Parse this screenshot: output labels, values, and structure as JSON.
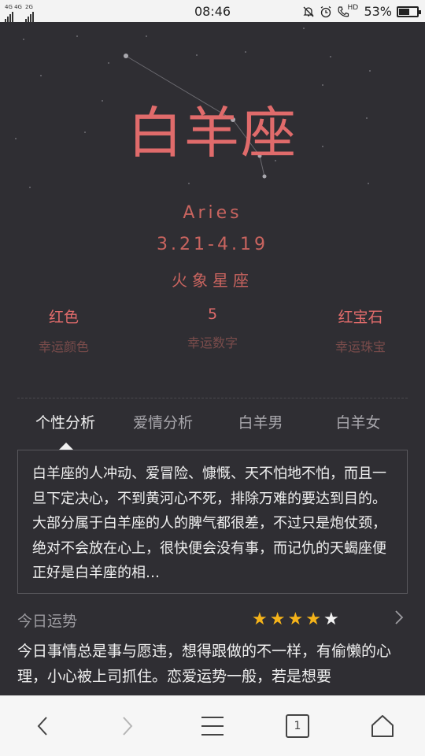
{
  "status_bar": {
    "network_left": "4G 4G",
    "network_right": "2G",
    "time": "08:46",
    "hd": "HD",
    "battery": "53%",
    "icons": [
      "mute-icon",
      "alarm-icon",
      "phone-hd-icon",
      "battery-icon"
    ]
  },
  "zodiac": {
    "name": "白羊座",
    "english": "Aries",
    "dates": "3.21-4.19",
    "element": "火象星座"
  },
  "lucky": [
    {
      "value": "红色",
      "label": "幸运颜色"
    },
    {
      "value": "5",
      "label": "幸运数字"
    },
    {
      "value": "红宝石",
      "label": "幸运珠宝"
    }
  ],
  "tabs": [
    {
      "label": "个性分析",
      "active": true
    },
    {
      "label": "爱情分析",
      "active": false
    },
    {
      "label": "白羊男",
      "active": false
    },
    {
      "label": "白羊女",
      "active": false
    }
  ],
  "description": "白羊座的人冲动、爱冒险、慷慨、天不怕地不怕，而且一旦下定决心，不到黄河心不死，排除万难的要达到目的。大部分属于白羊座的人的脾气都很差，不过只是炮仗颈，绝对不会放在心上，很快便会没有事，而记仇的天蝎座便正好是白羊座的相…",
  "fortune": {
    "title": "今日运势",
    "rating": 4,
    "max_rating": 5,
    "text": "今日事情总是事与愿违，想得跟做的不一样，有偷懒的心理，小心被上司抓住。恋爱运势一般，若是想要"
  },
  "browser_nav": {
    "tab_count": "1",
    "icons": [
      "back-icon",
      "forward-icon",
      "menu-icon",
      "tabs-icon",
      "home-icon"
    ]
  },
  "colors": {
    "background": "#2f2e33",
    "accent": "#e06b6b",
    "star": "#f4b31a"
  }
}
